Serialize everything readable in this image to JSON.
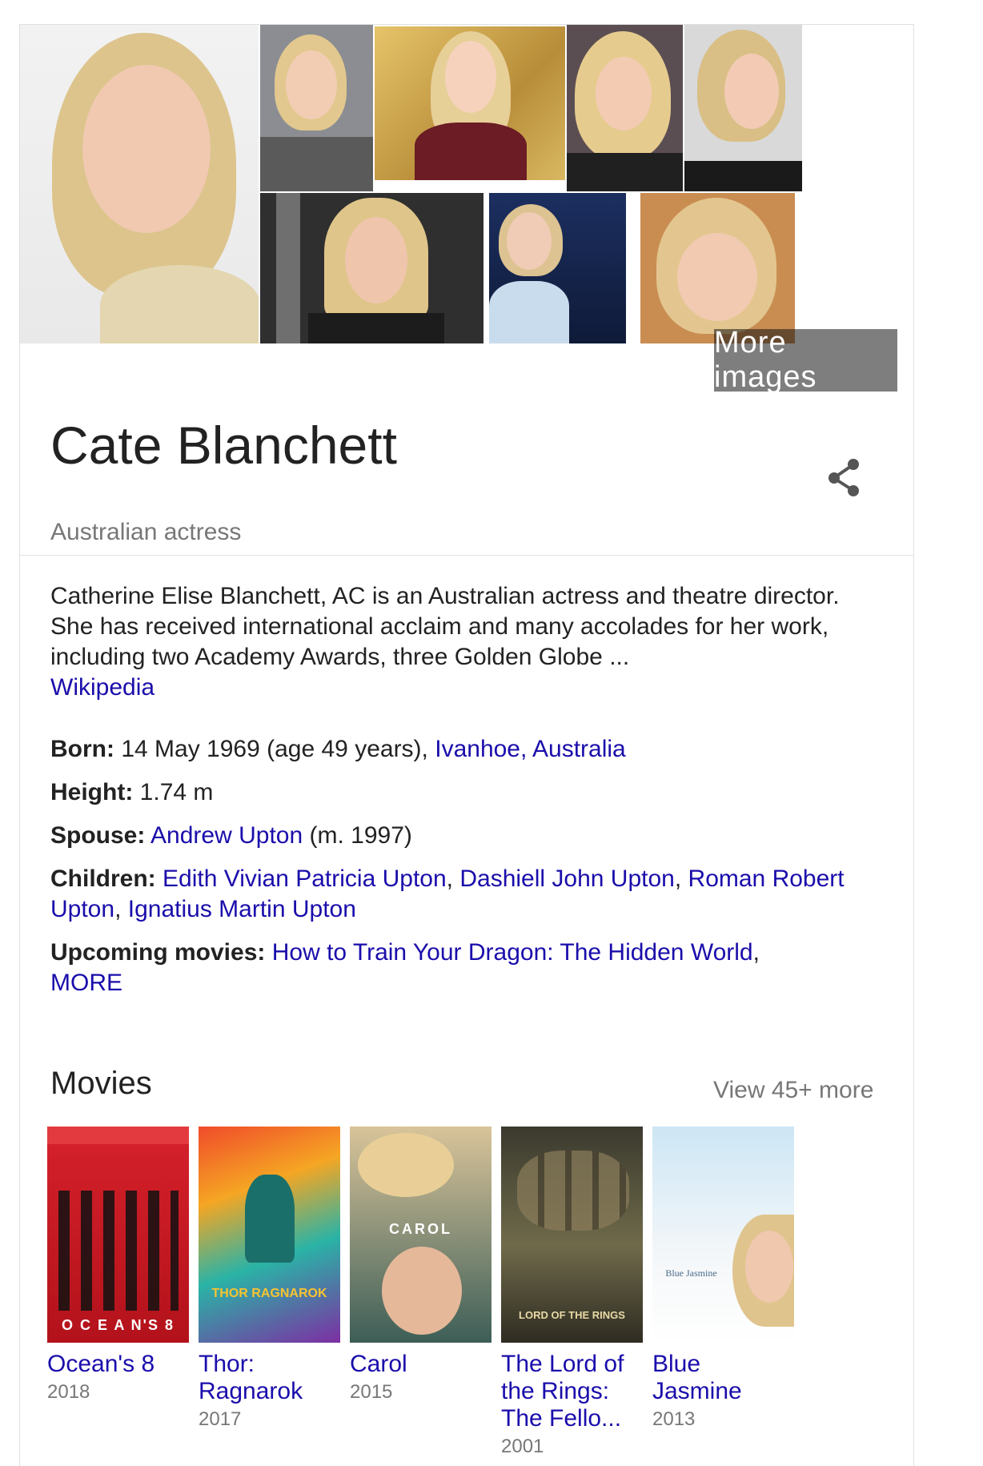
{
  "images": {
    "more_label": "More images"
  },
  "header": {
    "title": "Cate Blanchett",
    "subtitle": "Australian actress",
    "share_icon": "share-icon"
  },
  "description": {
    "text": "Catherine Elise Blanchett, AC is an Australian actress and theatre director. She has received international acclaim and many accolades for her work, including two Academy Awards, three Golden Globe ...",
    "source_link": "Wikipedia"
  },
  "facts": {
    "born": {
      "label": "Born:",
      "value": "14 May 1969 (age 49 years),",
      "link": "Ivanhoe, Australia"
    },
    "height": {
      "label": "Height:",
      "value": "1.74 m"
    },
    "spouse": {
      "label": "Spouse:",
      "link": "Andrew Upton",
      "suffix": "(m. 1997)"
    },
    "children": {
      "label": "Children:",
      "links": [
        "Edith Vivian Patricia Upton",
        "Dashiell John Upton",
        "Roman Robert Upton",
        "Ignatius Martin Upton"
      ],
      "separator": ","
    },
    "upcoming": {
      "label": "Upcoming movies:",
      "link": "How to Train Your Dragon: The Hidden World",
      "separator": ",",
      "more": "MORE"
    }
  },
  "movies": {
    "heading": "Movies",
    "view_more": "View 45+ more",
    "items": [
      {
        "title": "Ocean's 8",
        "year": "2018",
        "poster_text": "O C E A N'S 8"
      },
      {
        "title": "Thor: Ragnarok",
        "year": "2017",
        "poster_text": "THOR RAGNAROK"
      },
      {
        "title": "Carol",
        "year": "2015",
        "poster_text": "CAROL"
      },
      {
        "title": "The Lord of the Rings: The Fello...",
        "year": "2001",
        "poster_text": "LORD OF THE RINGS"
      },
      {
        "title": "Blue Jasmine",
        "year": "2013",
        "poster_text": "Blue Jasmine"
      }
    ]
  },
  "colors": {
    "link": "#1a0dab",
    "muted": "#777777",
    "text": "#222222",
    "divider": "#e4e4e4"
  }
}
